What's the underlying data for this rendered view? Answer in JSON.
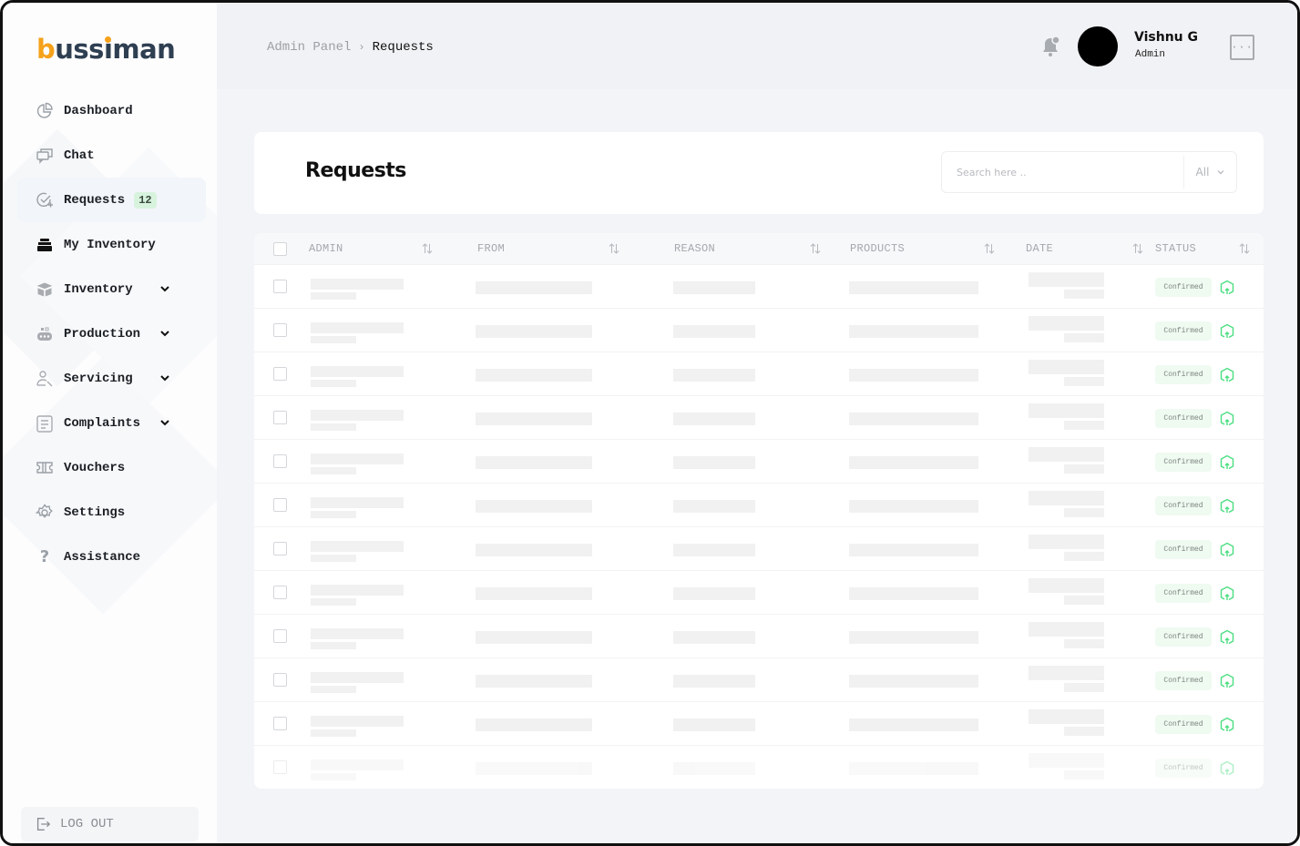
{
  "app": {
    "logo_prefix": "b",
    "logo_middle": "ussi",
    "logo_accent_i": "",
    "logo_text": "bussiman",
    "brand_color": "#f5a21b",
    "brand_dark": "#2f3f52"
  },
  "sidebar": {
    "items": [
      {
        "label": "Dashboard",
        "icon": "pie-chart-icon",
        "active": false,
        "expandable": false
      },
      {
        "label": "Chat",
        "icon": "chat-icon",
        "active": false,
        "expandable": false
      },
      {
        "label": "Requests",
        "icon": "request-check-icon",
        "active": true,
        "expandable": false,
        "badge": "12"
      },
      {
        "label": "My Inventory",
        "icon": "stack-icon",
        "active": false,
        "expandable": false
      },
      {
        "label": "Inventory",
        "icon": "box-icon",
        "active": false,
        "expandable": true
      },
      {
        "label": "Production",
        "icon": "production-robot-icon",
        "active": false,
        "expandable": true
      },
      {
        "label": "Servicing",
        "icon": "user-wrench-icon",
        "active": false,
        "expandable": true
      },
      {
        "label": "Complaints",
        "icon": "document-icon",
        "active": false,
        "expandable": true
      },
      {
        "label": "Vouchers",
        "icon": "ticket-icon",
        "active": false,
        "expandable": false
      },
      {
        "label": "Settings",
        "icon": "gear-icon",
        "active": false,
        "expandable": false
      },
      {
        "label": "Assistance",
        "icon": "question-icon",
        "active": false,
        "expandable": false
      }
    ],
    "logout_label": "LOG OUT"
  },
  "topbar": {
    "breadcrumb": {
      "root": "Admin Panel",
      "separator": "›",
      "current": "Requests"
    },
    "user": {
      "name": "Vishnu G",
      "role": "Admin"
    },
    "more_label": "···"
  },
  "page": {
    "title": "Requests",
    "search": {
      "placeholder": "Search here ..",
      "value": ""
    },
    "filter": {
      "selected": "All"
    }
  },
  "table": {
    "columns": [
      "ADMIN",
      "FROM",
      "REASON",
      "PRODUCTS",
      "DATE",
      "STATUS"
    ],
    "rows": [
      {
        "status": "Confirmed",
        "loading": true
      },
      {
        "status": "Confirmed",
        "loading": true
      },
      {
        "status": "Confirmed",
        "loading": true
      },
      {
        "status": "Confirmed",
        "loading": true
      },
      {
        "status": "Confirmed",
        "loading": true
      },
      {
        "status": "Confirmed",
        "loading": true
      },
      {
        "status": "Confirmed",
        "loading": true
      },
      {
        "status": "Confirmed",
        "loading": true
      },
      {
        "status": "Confirmed",
        "loading": true
      },
      {
        "status": "Confirmed",
        "loading": true
      },
      {
        "status": "Confirmed",
        "loading": true
      },
      {
        "status": "Confirmed",
        "loading": true
      }
    ],
    "status_color": "#effaf1",
    "action_icon_color": "#4ade80"
  }
}
